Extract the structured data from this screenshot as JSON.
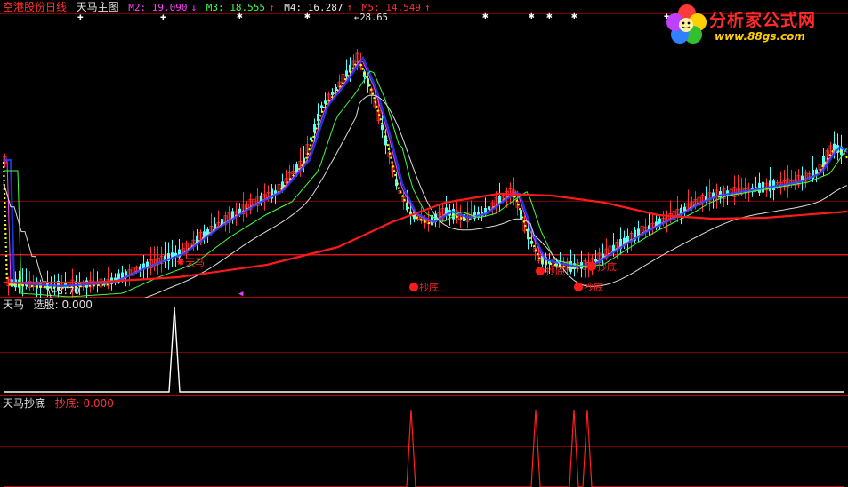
{
  "header": {
    "stock_name": "空港股份",
    "period": "日线",
    "indicator": "天马主图",
    "ma": [
      {
        "label": "M2: 19.090",
        "arrow": "↓",
        "color": "#ff40ff"
      },
      {
        "label": "M3: 18.555",
        "arrow": "↑",
        "color": "#40ff40"
      },
      {
        "label": "M4: 16.287",
        "arrow": "↑",
        "color": "#e8e8e8"
      },
      {
        "label": "M5: 14.549",
        "arrow": "↑",
        "color": "#ff3030"
      }
    ]
  },
  "main_chart": {
    "high_label": "28.65",
    "low_label": "8.70",
    "signals": [
      {
        "text": "天马",
        "kind": "select"
      },
      {
        "text": "抄底",
        "kind": "dip"
      },
      {
        "text": "抄底",
        "kind": "dip"
      },
      {
        "text": "抄底",
        "kind": "dip"
      },
      {
        "text": "抄底",
        "kind": "dip"
      },
      {
        "text": "抄底",
        "kind": "dip"
      }
    ]
  },
  "select_panel": {
    "title": "天马",
    "value_label": "选股: 0.000"
  },
  "dip_panel": {
    "title": "天马抄底",
    "value_label": "抄底: 0.000"
  },
  "logo": {
    "title": "分析家公式网",
    "url": "www.88gs.com"
  },
  "colors": {
    "up": "#ff3232",
    "down": "#54ffff",
    "grid": "#800000",
    "ma_short": "#ffff00",
    "ma_blue": "#2040ff"
  }
}
